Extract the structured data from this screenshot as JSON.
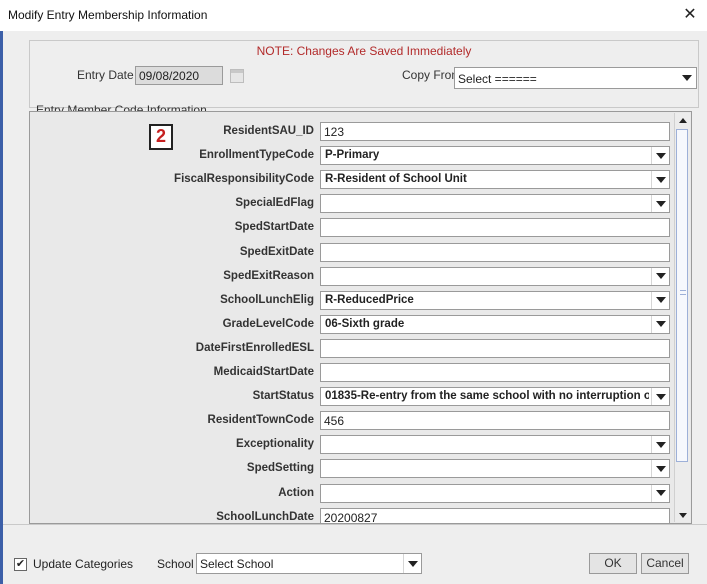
{
  "window": {
    "title": "Modify Entry Membership Information",
    "close_glyph": "✕"
  },
  "header": {
    "notice": "NOTE: Changes Are Saved Immediately",
    "entry_date_label": "Entry Date",
    "entry_date_value": "09/08/2020",
    "copy_from_label": "Copy From",
    "copy_from_value": "Select ======"
  },
  "section_title": "Entry Member Code Information",
  "badge": "2",
  "fields": [
    {
      "label": "ResidentSAU_ID",
      "type": "text",
      "value": "123"
    },
    {
      "label": "EnrollmentTypeCode",
      "type": "select",
      "value": "P-Primary"
    },
    {
      "label": "FiscalResponsibilityCode",
      "type": "select",
      "value": "R-Resident of School Unit"
    },
    {
      "label": "SpecialEdFlag",
      "type": "select",
      "value": ""
    },
    {
      "label": "SpedStartDate",
      "type": "text",
      "value": ""
    },
    {
      "label": "SpedExitDate",
      "type": "text",
      "value": ""
    },
    {
      "label": "SpedExitReason",
      "type": "select",
      "value": ""
    },
    {
      "label": "SchoolLunchElig",
      "type": "select",
      "value": "R-ReducedPrice"
    },
    {
      "label": "GradeLevelCode",
      "type": "select",
      "value": "06-Sixth grade"
    },
    {
      "label": "DateFirstEnrolledESL",
      "type": "text",
      "value": ""
    },
    {
      "label": "MedicaidStartDate",
      "type": "text",
      "value": ""
    },
    {
      "label": "StartStatus",
      "type": "select",
      "value": "01835-Re-entry from the same school with no interruption o..."
    },
    {
      "label": "ResidentTownCode",
      "type": "text",
      "value": "456"
    },
    {
      "label": "Exceptionality",
      "type": "select",
      "value": ""
    },
    {
      "label": "SpedSetting",
      "type": "select",
      "value": ""
    },
    {
      "label": "Action",
      "type": "select",
      "value": ""
    },
    {
      "label": "SchoolLunchDate",
      "type": "text",
      "value": "20200827"
    }
  ],
  "footer": {
    "update_checked": true,
    "update_label": "Update Categories",
    "school_label": "School",
    "school_value": "Select School",
    "ok_label": "OK",
    "cancel_label": "Cancel"
  }
}
